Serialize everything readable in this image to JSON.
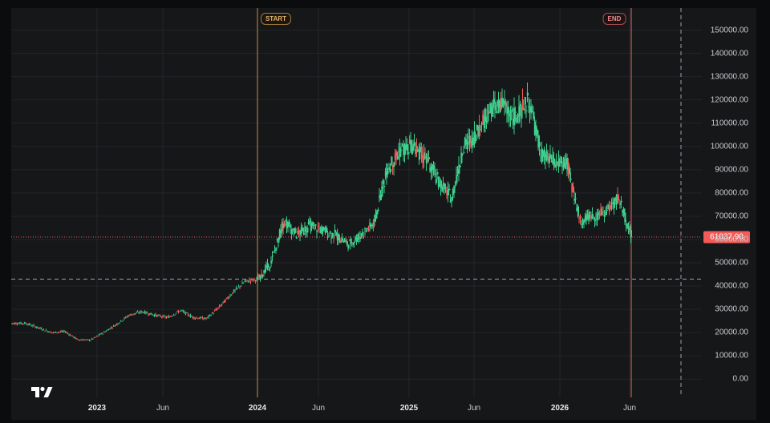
{
  "price_axis": {
    "ticks": [
      "150000.00",
      "140000.00",
      "130000.00",
      "120000.00",
      "110000.00",
      "100000.00",
      "90000.00",
      "80000.00",
      "70000.00",
      "60000.00",
      "50000.00",
      "40000.00",
      "30000.00",
      "20000.00",
      "10000.00",
      "0.00"
    ],
    "tick_values": [
      150000,
      140000,
      130000,
      120000,
      110000,
      100000,
      90000,
      80000,
      70000,
      60000,
      50000,
      40000,
      30000,
      20000,
      10000,
      0
    ],
    "last_price": "61037.90"
  },
  "time_axis": {
    "labels": [
      {
        "text": "2023",
        "bold": true
      },
      {
        "text": "Jun",
        "bold": false
      },
      {
        "text": "2024",
        "bold": true
      },
      {
        "text": "Jun",
        "bold": false
      },
      {
        "text": "2025",
        "bold": true
      },
      {
        "text": "Jun",
        "bold": false
      },
      {
        "text": "2026",
        "bold": true
      },
      {
        "text": "Jun",
        "bold": false
      }
    ]
  },
  "markers": {
    "start": "START",
    "end": "END"
  },
  "colors": {
    "up": "#2fbd85",
    "down": "#f25b58",
    "highlight": "#3ecf8e",
    "start_line": "#c8903e",
    "end_line": "#e36a6a",
    "background": "#151719"
  },
  "logo": "tradingview-logo",
  "chart_data": {
    "type": "line",
    "title": "",
    "xlabel": "",
    "ylabel": "",
    "ylim": [
      0,
      150000
    ],
    "last_value": 61037.9,
    "reference_level": 43000,
    "series": [
      {
        "x": [
          "2022-07",
          "2022-08",
          "2022-09",
          "2022-10",
          "2022-11",
          "2022-12",
          "2023-01",
          "2023-02",
          "2023-03",
          "2023-04",
          "2023-05",
          "2023-06",
          "2023-07",
          "2023-08",
          "2023-09",
          "2023-10",
          "2023-11",
          "2023-12",
          "2024-01",
          "2024-02",
          "2024-03",
          "2024-04",
          "2024-05",
          "2024-06",
          "2024-07",
          "2024-08",
          "2024-09",
          "2024-10",
          "2024-11",
          "2024-12",
          "2025-01",
          "2025-02",
          "2025-03",
          "2025-04",
          "2025-05",
          "2025-06",
          "2025-07",
          "2025-08",
          "2025-09",
          "2025-10",
          "2025-11",
          "2025-12",
          "2026-01",
          "2026-02",
          "2026-03",
          "2026-04",
          "2026-05",
          "2026-06"
        ],
        "values": [
          24000,
          22000,
          20000,
          20500,
          17000,
          16800,
          20000,
          23500,
          27500,
          29000,
          27500,
          26500,
          29500,
          26500,
          26000,
          31000,
          37000,
          42000,
          43000,
          50000,
          68000,
          62000,
          66000,
          64000,
          62000,
          58000,
          62000,
          67000,
          90000,
          98000,
          100000,
          95000,
          85000,
          78000,
          100000,
          106000,
          116000,
          118000,
          112000,
          120000,
          96000,
          93000,
          92000,
          68000,
          70000,
          72000,
          78000,
          61037.9
        ]
      }
    ]
  }
}
